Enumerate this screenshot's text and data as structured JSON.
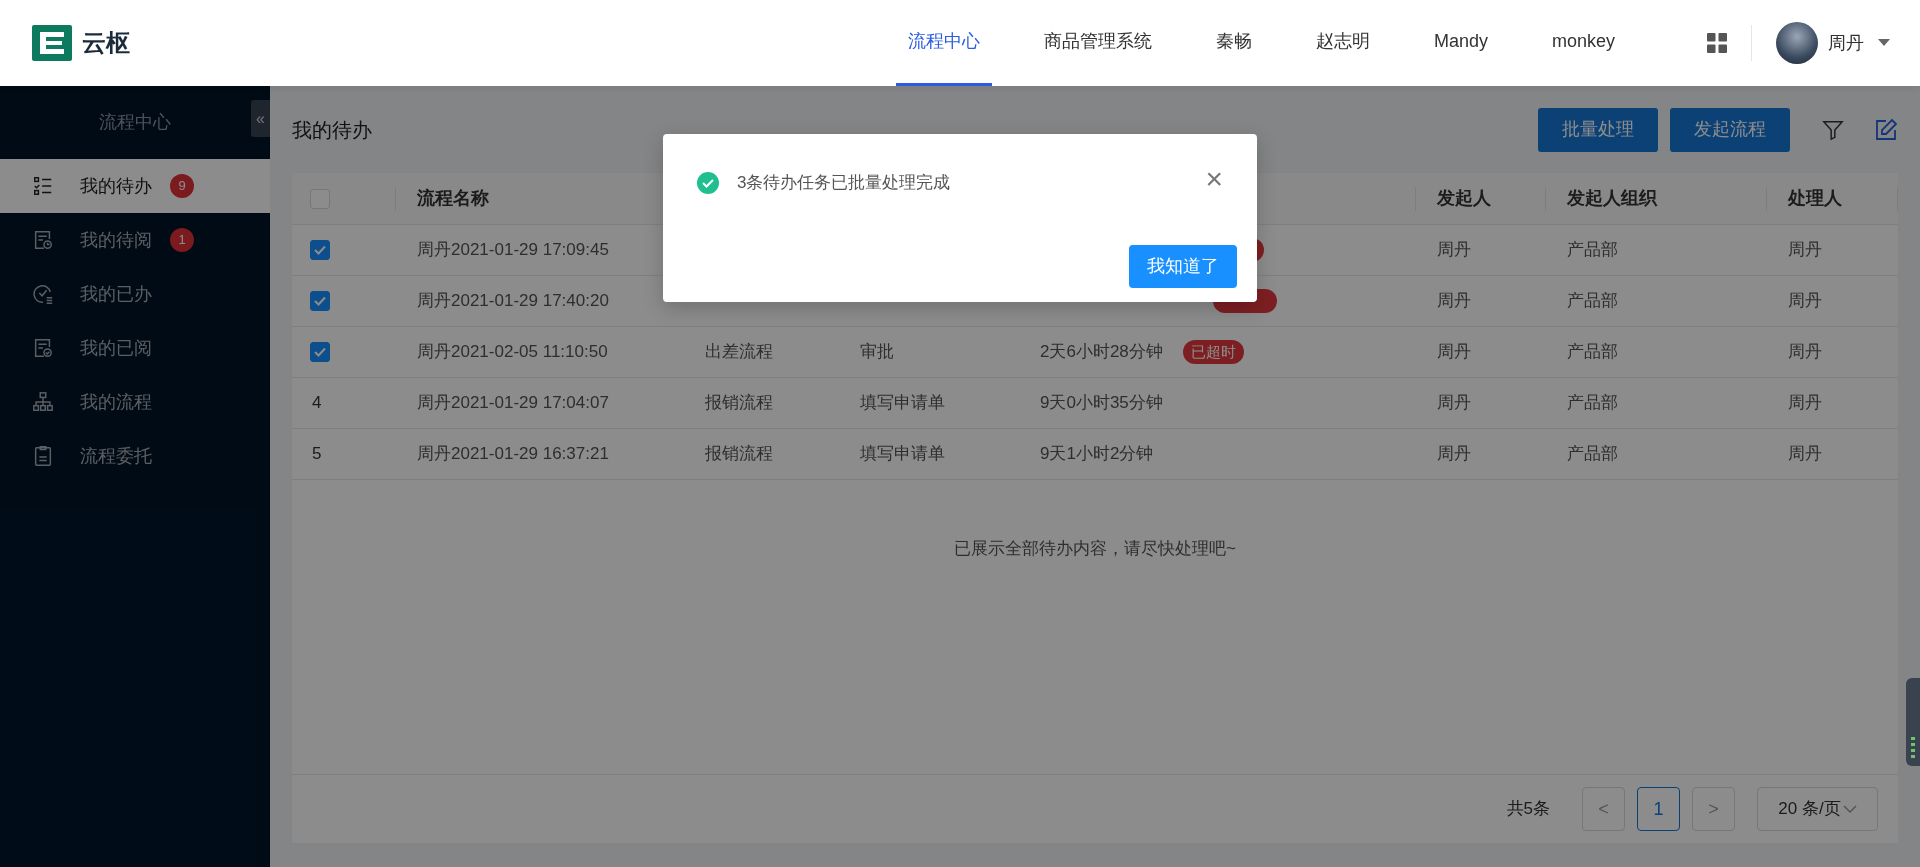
{
  "header": {
    "logo_text": "云枢",
    "nav": [
      {
        "label": "流程中心",
        "selected": true
      },
      {
        "label": "商品管理系统",
        "selected": false
      },
      {
        "label": "秦畅",
        "selected": false
      },
      {
        "label": "赵志明",
        "selected": false
      },
      {
        "label": "Mandy",
        "selected": false
      },
      {
        "label": "monkey",
        "selected": false
      }
    ],
    "user": "周丹"
  },
  "sidebar": {
    "title": "流程中心",
    "collapse_icon": "«",
    "items": [
      {
        "label": "我的待办",
        "badge": "9",
        "selected": true
      },
      {
        "label": "我的待阅",
        "badge": "1",
        "selected": false
      },
      {
        "label": "我的已办",
        "selected": false
      },
      {
        "label": "我的已阅",
        "selected": false
      },
      {
        "label": "我的流程",
        "selected": false
      },
      {
        "label": "流程委托",
        "selected": false
      }
    ]
  },
  "page": {
    "title": "我的待办",
    "buttons": [
      "批量处理",
      "发起流程"
    ]
  },
  "table": {
    "select_all_checked": false,
    "header": {
      "name": "流程名称",
      "starter": "发起人",
      "org": "发起人组织",
      "handler": "处理人"
    },
    "rows": [
      {
        "checked": true,
        "name": "周丹2021-01-29 17:09:45",
        "overdue": true,
        "starter": "周丹",
        "org": "产品部",
        "handler": "周丹"
      },
      {
        "checked": true,
        "name": "周丹2021-01-29 17:40:20",
        "overdue": true,
        "starter": "周丹",
        "org": "产品部",
        "handler": "周丹"
      },
      {
        "checked": true,
        "name": "周丹2021-02-05 11:10:50",
        "type": "出差流程",
        "node": "审批",
        "duration": "2天6小时28分钟",
        "overdue": true,
        "badge_label": "已超时",
        "starter": "周丹",
        "org": "产品部",
        "handler": "周丹"
      },
      {
        "checked": false,
        "index": "4",
        "name": "周丹2021-01-29 17:04:07",
        "type": "报销流程",
        "node": "填写申请单",
        "duration": "9天0小时35分钟",
        "overdue": false,
        "starter": "周丹",
        "org": "产品部",
        "handler": "周丹"
      },
      {
        "checked": false,
        "index": "5",
        "name": "周丹2021-01-29 16:37:21",
        "type": "报销流程",
        "node": "填写申请单",
        "duration": "9天1小时2分钟",
        "overdue": false,
        "starter": "周丹",
        "org": "产品部",
        "handler": "周丹"
      }
    ],
    "empty_note": "已展示全部待办内容，请尽快处理吧~"
  },
  "pagination": {
    "total": "共5条",
    "prev": "<",
    "next": ">",
    "pages": [
      {
        "label": "1",
        "selected": true
      }
    ],
    "page_size": "20 条/页"
  },
  "dialog": {
    "message": "3条待办任务已批量处理完成",
    "close": "×",
    "button": "我知道了"
  }
}
